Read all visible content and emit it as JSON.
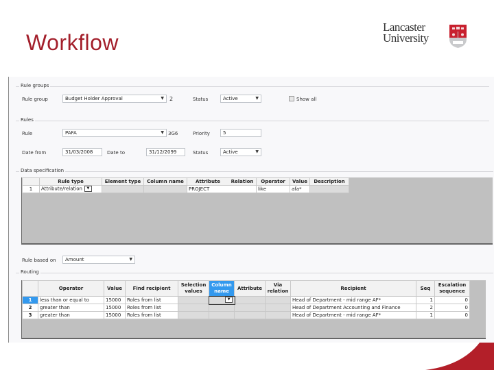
{
  "slide": {
    "title": "Workflow",
    "logo": {
      "line1": "Lancaster",
      "line2": "University"
    }
  },
  "rule_groups": {
    "section_label": "Rule groups",
    "rule_group_label": "Rule group",
    "rule_group_value": "Budget Holder Approval",
    "rule_group_id": "2",
    "status_label": "Status",
    "status_value": "Active",
    "show_all_label": "Show all",
    "show_all_checked": false
  },
  "rules": {
    "section_label": "Rules",
    "rule_label": "Rule",
    "rule_value": "PAFA",
    "rule_id": "3G6",
    "priority_label": "Priority",
    "priority_value": "5",
    "date_from_label": "Date from",
    "date_from_value": "31/03/2008",
    "date_to_label": "Date to",
    "date_to_value": "31/12/2099",
    "status_label": "Status",
    "status_value": "Active"
  },
  "data_specification": {
    "section_label": "Data specification",
    "columns": [
      "Rule type",
      "Element type",
      "Column name",
      "Attribute",
      "Relation",
      "Operator",
      "Value",
      "Description"
    ],
    "rows": [
      {
        "no": "1",
        "rule_type": "Attribute/relation",
        "element_type": "",
        "column_name": "",
        "attribute": "PROJECT",
        "relation": "",
        "operator": "like",
        "value": "afa*",
        "description": ""
      }
    ]
  },
  "rule_based_on": {
    "label": "Rule based on",
    "value": "Amount"
  },
  "routing": {
    "section_label": "Routing",
    "columns": [
      "Operator",
      "Value",
      "Find recipient",
      "Selection values",
      "Column name",
      "Attribute",
      "Via relation",
      "Recipient",
      "Seq",
      "Escalation sequence"
    ],
    "rows": [
      {
        "no": "1",
        "operator": "less than or equal to",
        "value": "15000",
        "find_recipient": "Roles from list",
        "selection_values": "",
        "column_name": "",
        "attribute": "",
        "via_relation": "",
        "recipient": "Head of Department - mid range AF*",
        "seq": "1",
        "escalation_sequence": "0"
      },
      {
        "no": "2",
        "operator": "greater than",
        "value": "15000",
        "find_recipient": "Roles from list",
        "selection_values": "",
        "column_name": "",
        "attribute": "",
        "via_relation": "",
        "recipient": "Head of Department Accounting and Finance",
        "seq": "2",
        "escalation_sequence": "0"
      },
      {
        "no": "3",
        "operator": "greater than",
        "value": "15000",
        "find_recipient": "Roles from list",
        "selection_values": "",
        "column_name": "",
        "attribute": "",
        "via_relation": "",
        "recipient": "Head of Department - mid range AF*",
        "seq": "1",
        "escalation_sequence": "0"
      }
    ]
  },
  "colors": {
    "title_red": "#a31f2b",
    "selection_blue": "#3399ee",
    "grid_background": "#c0c0c0"
  }
}
